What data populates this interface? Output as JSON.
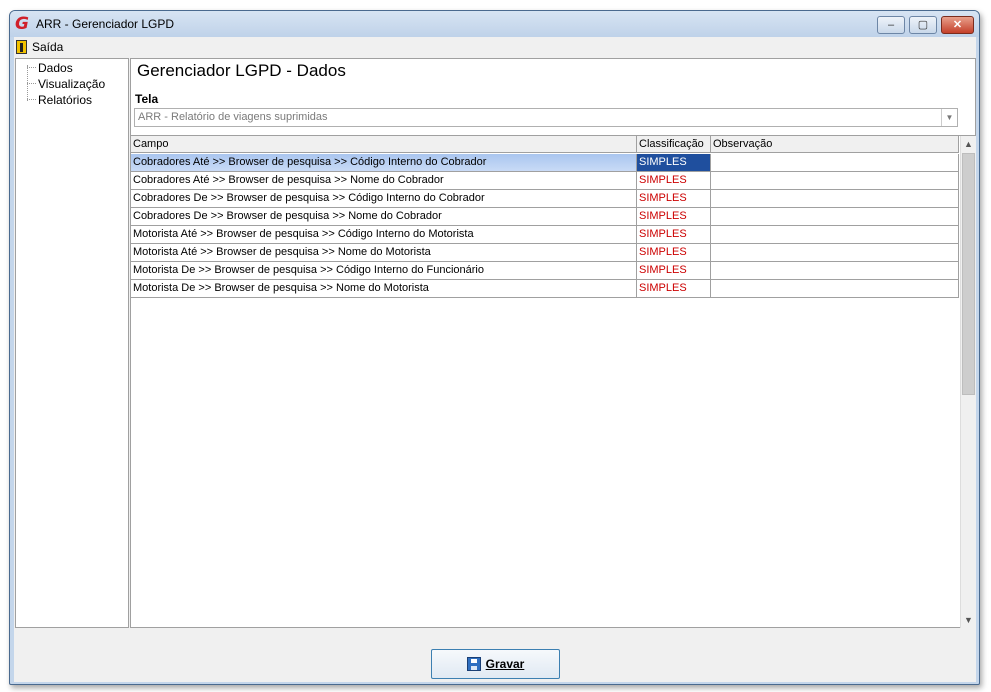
{
  "window": {
    "title": "ARR - Gerenciador LGPD",
    "app_icon_glyph": "G",
    "controls": {
      "minimize": "–",
      "maximize": "▢",
      "close": "✕"
    }
  },
  "menu": {
    "exit_label": "Saída"
  },
  "sidebar": {
    "items": [
      {
        "label": "Dados"
      },
      {
        "label": "Visualização"
      },
      {
        "label": "Relatórios"
      }
    ]
  },
  "page": {
    "title": "Gerenciador LGPD - Dados",
    "tela_label": "Tela",
    "tela_value": "ARR - Relatório de viagens suprimidas",
    "combo_arrow": "▼"
  },
  "grid": {
    "columns": [
      "Campo",
      "Classificação",
      "Observação"
    ],
    "rows": [
      {
        "campo": "Cobradores Até >> Browser de pesquisa >> Código Interno do Cobrador",
        "classificacao": "SIMPLES",
        "observacao": ""
      },
      {
        "campo": "Cobradores Até >> Browser de pesquisa >> Nome do Cobrador",
        "classificacao": "SIMPLES",
        "observacao": ""
      },
      {
        "campo": "Cobradores De >> Browser de pesquisa >> Código Interno do Cobrador",
        "classificacao": "SIMPLES",
        "observacao": ""
      },
      {
        "campo": "Cobradores De >> Browser de pesquisa >> Nome do Cobrador",
        "classificacao": "SIMPLES",
        "observacao": ""
      },
      {
        "campo": "Motorista Até >> Browser de pesquisa >> Código Interno do Motorista",
        "classificacao": "SIMPLES",
        "observacao": ""
      },
      {
        "campo": "Motorista Até >> Browser de pesquisa >> Nome do Motorista",
        "classificacao": "SIMPLES",
        "observacao": ""
      },
      {
        "campo": "Motorista De >> Browser de pesquisa >> Código Interno do Funcionário",
        "classificacao": "SIMPLES",
        "observacao": ""
      },
      {
        "campo": "Motorista De >> Browser de pesquisa >> Nome do Motorista",
        "classificacao": "SIMPLES",
        "observacao": ""
      }
    ],
    "scroll": {
      "up": "▲",
      "down": "▼"
    }
  },
  "actions": {
    "save_label": "Gravar"
  },
  "colors": {
    "classification_text": "#cc0000",
    "selection": "#1f4f9e"
  }
}
